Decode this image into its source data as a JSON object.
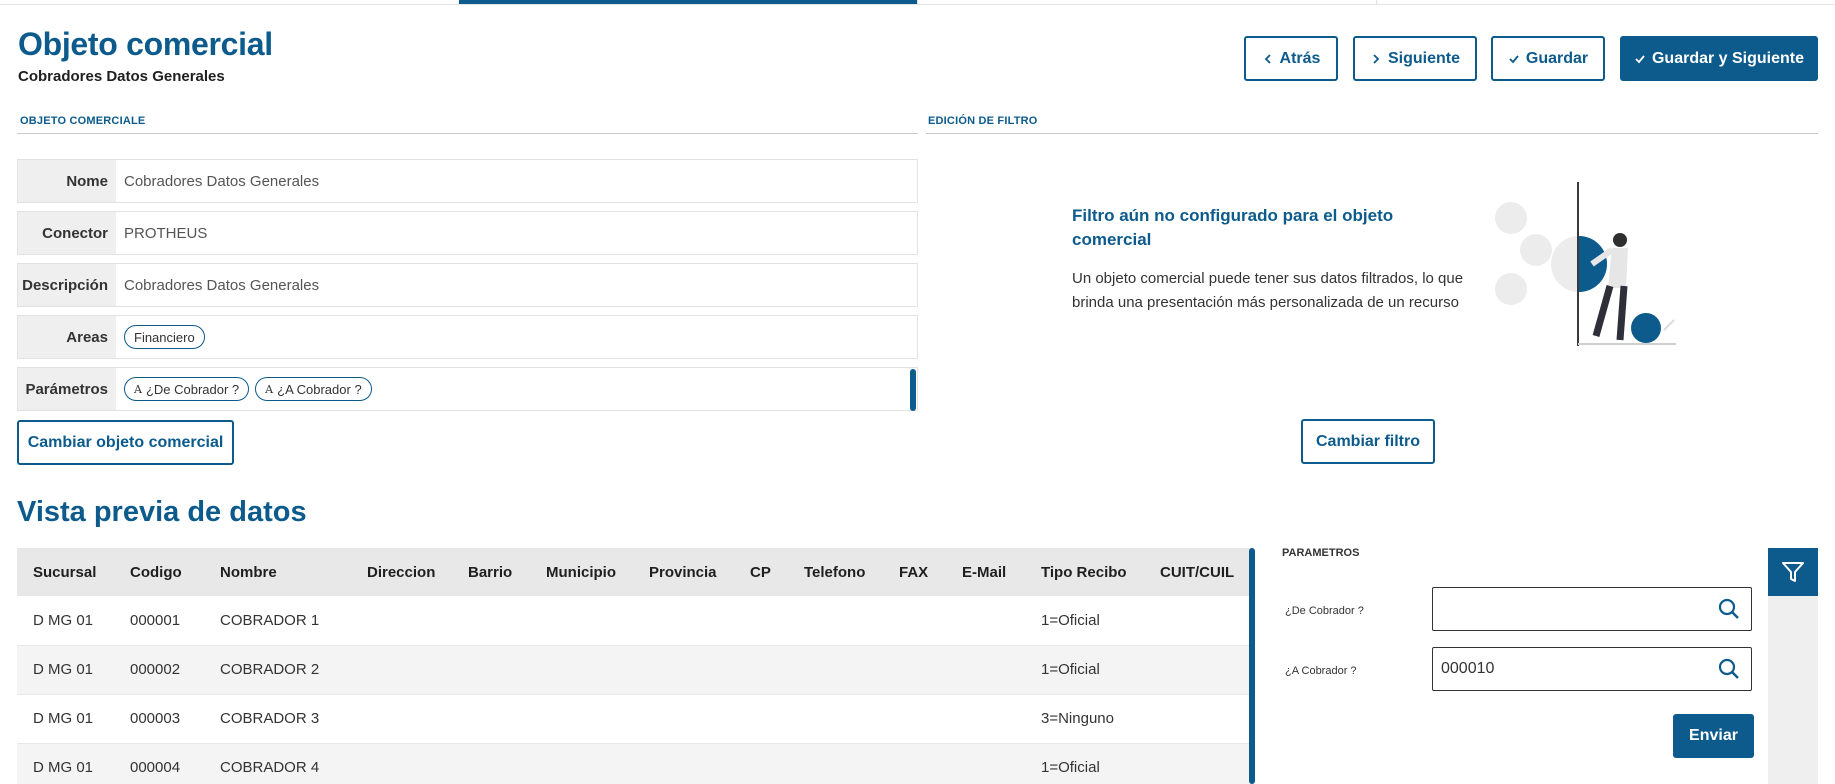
{
  "header": {
    "title": "Objeto comercial",
    "subtitle": "Cobradores Datos Generales"
  },
  "actions": {
    "back": "Atrás",
    "next": "Siguiente",
    "save": "Guardar",
    "save_next": "Guardar y Siguiente"
  },
  "business_object": {
    "section_label": "OBJETO COMERCIALE",
    "fields": [
      {
        "label": "Nome",
        "value": "Cobradores Datos Generales"
      },
      {
        "label": "Conector",
        "value": "PROTHEUS"
      },
      {
        "label": "Descripción",
        "value": "Cobradores Datos Generales"
      },
      {
        "label": "Areas",
        "chips": [
          "Financiero"
        ]
      },
      {
        "label": "Parámetros",
        "chips": [
          "¿De Cobrador ?",
          "¿A Cobrador ?"
        ],
        "chip_glyph": "A"
      }
    ],
    "change_button": "Cambiar objeto comercial"
  },
  "filter": {
    "section_label": "EDICIÓN DE FILTRO",
    "empty_title": "Filtro aún no configurado para el objeto comercial",
    "empty_desc": "Un objeto comercial puede tener sus datos filtrados, lo que brinda una presentación más personalizada de un recurso",
    "change_button": "Cambiar filtro"
  },
  "preview": {
    "title": "Vista previa de datos",
    "columns": [
      "Sucursal",
      "Codigo",
      "Nombre",
      "Direccion",
      "Barrio",
      "Municipio",
      "Provincia",
      "CP",
      "Telefono",
      "FAX",
      "E-Mail",
      "Tipo Recibo",
      "CUIT/CUIL"
    ],
    "rows": [
      [
        "D MG 01",
        "000001",
        "COBRADOR 1",
        "",
        "",
        "",
        "",
        "",
        "",
        "",
        "",
        "1=Oficial",
        ""
      ],
      [
        "D MG 01",
        "000002",
        "COBRADOR 2",
        "",
        "",
        "",
        "",
        "",
        "",
        "",
        "",
        "1=Oficial",
        ""
      ],
      [
        "D MG 01",
        "000003",
        "COBRADOR 3",
        "",
        "",
        "",
        "",
        "",
        "",
        "",
        "",
        "3=Ninguno",
        ""
      ],
      [
        "D MG 01",
        "000004",
        "COBRADOR 4",
        "",
        "",
        "",
        "",
        "",
        "",
        "",
        "",
        "1=Oficial",
        ""
      ]
    ]
  },
  "params": {
    "title": "PARAMETROS",
    "items": [
      {
        "label": "¿De Cobrador ?",
        "value": ""
      },
      {
        "label": "¿A Cobrador ?",
        "value": "000010"
      }
    ],
    "send": "Enviar"
  },
  "colors": {
    "accent": "#0c5b8c",
    "header_bg": "#e8e8e8",
    "label_bg": "#efefef"
  },
  "icons": {
    "back": "chevron-left-icon",
    "next": "chevron-right-icon",
    "save": "check-icon",
    "search": "search-icon",
    "filter": "filter-icon"
  }
}
